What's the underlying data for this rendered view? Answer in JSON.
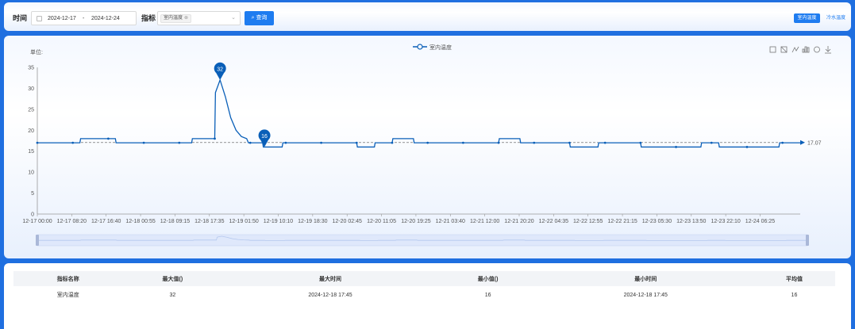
{
  "filter": {
    "time_label": "时间",
    "start_date": "2024-12-17",
    "date_separator": "-",
    "end_date": "2024-12-24",
    "metric_label": "指标",
    "selected_metric": "室内温度",
    "query_button": "查询"
  },
  "tabs": [
    {
      "label": "室内温度",
      "active": true
    },
    {
      "label": "冷水温度",
      "active": false
    }
  ],
  "toolbox_icons": [
    "zoom-icon",
    "zoom-reset-icon",
    "line-chart-icon",
    "bar-chart-icon",
    "restore-icon",
    "download-icon"
  ],
  "chart_data": {
    "type": "line",
    "unit_label": "单位:",
    "series": [
      {
        "name": "室内温度",
        "color": "#0a5fb8",
        "points": [
          [
            0,
            17
          ],
          [
            1.2,
            17
          ],
          [
            1.22,
            18
          ],
          [
            2.2,
            18
          ],
          [
            2.22,
            17
          ],
          [
            4.35,
            17
          ],
          [
            4.37,
            18
          ],
          [
            5.0,
            18
          ],
          [
            5.02,
            29
          ],
          [
            5.15,
            32
          ],
          [
            5.3,
            28
          ],
          [
            5.45,
            23
          ],
          [
            5.6,
            20
          ],
          [
            5.75,
            18.5
          ],
          [
            5.9,
            18
          ],
          [
            5.95,
            17
          ],
          [
            6.35,
            17
          ],
          [
            6.37,
            16
          ],
          [
            6.9,
            16
          ],
          [
            6.92,
            17
          ],
          [
            9.0,
            17
          ],
          [
            9.02,
            16
          ],
          [
            9.5,
            16
          ],
          [
            9.52,
            17
          ],
          [
            10.0,
            17
          ],
          [
            10.02,
            18
          ],
          [
            10.6,
            18
          ],
          [
            10.62,
            17
          ],
          [
            13.0,
            17
          ],
          [
            13.02,
            18
          ],
          [
            13.6,
            18
          ],
          [
            13.62,
            17
          ],
          [
            15.0,
            17
          ],
          [
            15.02,
            16
          ],
          [
            15.8,
            16
          ],
          [
            15.82,
            17
          ],
          [
            17.0,
            17
          ],
          [
            17.02,
            16
          ],
          [
            18.7,
            16
          ],
          [
            18.72,
            17
          ],
          [
            19.2,
            17
          ],
          [
            19.22,
            16
          ],
          [
            20.9,
            16
          ],
          [
            20.92,
            17
          ],
          [
            21.5,
            17
          ]
        ],
        "marked_max": {
          "x": 5.15,
          "value": 32,
          "label": "32"
        },
        "marked_min": {
          "x": 6.4,
          "value": 16,
          "label": "16"
        },
        "average": {
          "value": 17.07,
          "label": "17.07"
        }
      }
    ],
    "x_tick_labels": [
      "12-17 00:00",
      "12-17 08:20",
      "12-17 16:40",
      "12-18 00:55",
      "12-18 09:15",
      "12-18 17:35",
      "12-19 01:50",
      "12-19 10:10",
      "12-19 18:30",
      "12-20 02:45",
      "12-20 11:05",
      "12-20 19:25",
      "12-21 03:40",
      "12-21 12:00",
      "12-21 20:20",
      "12-22 04:35",
      "12-22 12:55",
      "12-22 21:15",
      "12-23 05:30",
      "12-23 13:50",
      "12-23 22:10",
      "12-24 06:25"
    ],
    "y_ticks": [
      0,
      5,
      10,
      15,
      20,
      25,
      30,
      35
    ],
    "ylim": [
      0,
      35
    ],
    "xlim": [
      0,
      21.5
    ],
    "grid": false,
    "legend_position": "top-center",
    "data_zoom": true
  },
  "summary_table": {
    "headers": [
      "指标名称",
      "最大值()",
      "最大时间",
      "最小值()",
      "最小时间",
      "平均值"
    ],
    "rows": [
      [
        "室内温度",
        "32",
        "2024-12-18 17:45",
        "16",
        "2024-12-18 17:45",
        "16"
      ]
    ]
  }
}
